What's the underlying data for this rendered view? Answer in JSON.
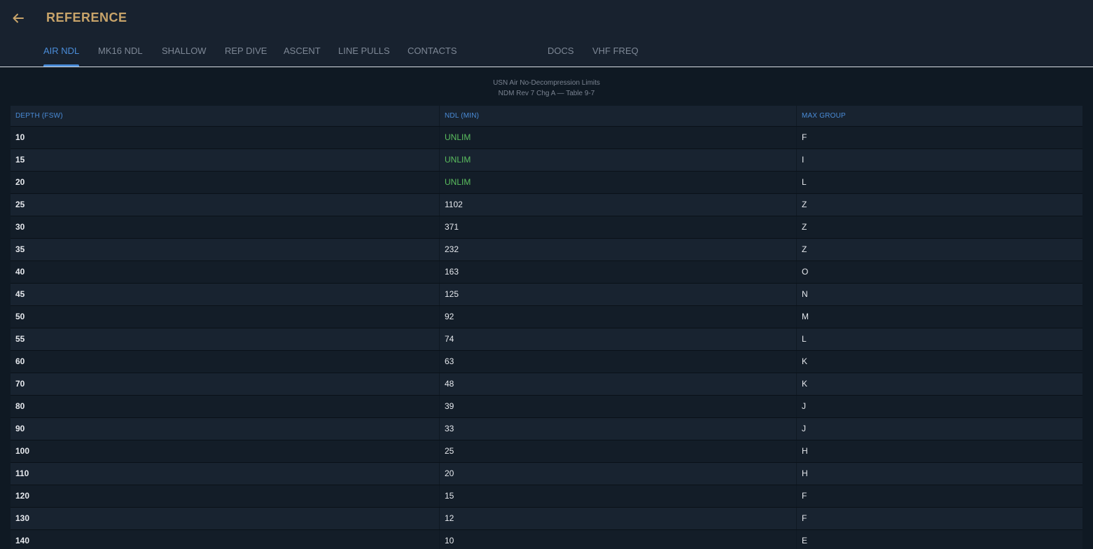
{
  "header": {
    "title": "REFERENCE"
  },
  "tabs": [
    {
      "label": "AIR NDL",
      "active": true
    },
    {
      "label": "MK16 NDL",
      "active": false
    },
    {
      "label": "SHALLOW",
      "active": false
    },
    {
      "label": "REP DIVE",
      "active": false
    },
    {
      "label": "ASCENT",
      "active": false
    },
    {
      "label": "LINE PULLS",
      "active": false
    },
    {
      "label": "CONTACTS",
      "active": false
    },
    {
      "label": "DOCS",
      "active": false
    },
    {
      "label": "VHF FREQ",
      "active": false
    }
  ],
  "caption": {
    "line1": "USN Air No-Decompression Limits",
    "line2": "NDM Rev 7 Chg A — Table 9-7"
  },
  "table": {
    "headers": [
      "DEPTH (FSW)",
      "NDL (MIN)",
      "MAX GROUP"
    ],
    "rows": [
      [
        "10",
        "UNLIM",
        "F"
      ],
      [
        "15",
        "UNLIM",
        "I"
      ],
      [
        "20",
        "UNLIM",
        "L"
      ],
      [
        "25",
        "1102",
        "Z"
      ],
      [
        "30",
        "371",
        "Z"
      ],
      [
        "35",
        "232",
        "Z"
      ],
      [
        "40",
        "163",
        "O"
      ],
      [
        "45",
        "125",
        "N"
      ],
      [
        "50",
        "92",
        "M"
      ],
      [
        "55",
        "74",
        "L"
      ],
      [
        "60",
        "63",
        "K"
      ],
      [
        "70",
        "48",
        "K"
      ],
      [
        "80",
        "39",
        "J"
      ],
      [
        "90",
        "33",
        "J"
      ],
      [
        "100",
        "25",
        "H"
      ],
      [
        "110",
        "20",
        "H"
      ],
      [
        "120",
        "15",
        "F"
      ],
      [
        "130",
        "12",
        "F"
      ],
      [
        "140",
        "10",
        "E"
      ]
    ]
  },
  "colors": {
    "accent": "#4a8cd8",
    "title": "#c8a46a",
    "unlimited": "#5bbf5f"
  },
  "icons": {
    "back": "arrow-left-icon"
  }
}
